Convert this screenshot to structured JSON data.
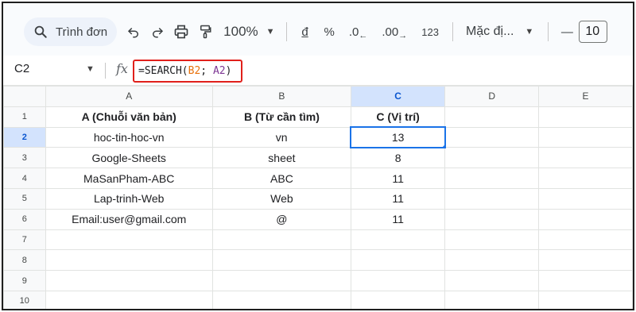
{
  "toolbar": {
    "menu_search_label": "Trình đơn",
    "zoom": "100%",
    "currency_label": "đ",
    "percent_label": "%",
    "decrease_decimal_label": ".0",
    "increase_decimal_label": ".00",
    "number_format_label": "123",
    "font_label": "Mặc đị...",
    "minus_label": "—",
    "font_size": "10"
  },
  "formula_bar": {
    "cell_ref": "C2",
    "fx_label": "fx",
    "formula_prefix": "=SEARCH(",
    "formula_ref1": "B2",
    "formula_sep": "; ",
    "formula_ref2": "A2",
    "formula_suffix": ")"
  },
  "sheet": {
    "columns": [
      "A",
      "B",
      "C",
      "D",
      "E"
    ],
    "rows": [
      {
        "n": "1",
        "a": "A (Chuỗi văn bản)",
        "b": "B (Từ cần tìm)",
        "c": "C (Vị trí)"
      },
      {
        "n": "2",
        "a": "hoc-tin-hoc-vn",
        "b": "vn",
        "c": "13"
      },
      {
        "n": "3",
        "a": "Google-Sheets",
        "b": "sheet",
        "c": "8"
      },
      {
        "n": "4",
        "a": "MaSanPham-ABC",
        "b": "ABC",
        "c": "11"
      },
      {
        "n": "5",
        "a": "Lap-trinh-Web",
        "b": "Web",
        "c": "11"
      },
      {
        "n": "6",
        "a": "Email:user@gmail.com",
        "b": "@",
        "c": "11"
      },
      {
        "n": "7",
        "a": "",
        "b": "",
        "c": ""
      },
      {
        "n": "8",
        "a": "",
        "b": "",
        "c": ""
      },
      {
        "n": "9",
        "a": "",
        "b": "",
        "c": ""
      },
      {
        "n": "10",
        "a": "",
        "b": "",
        "c": ""
      }
    ]
  },
  "colors": {
    "selection_blue": "#1a73e8",
    "highlight_red": "#e0201b",
    "ref_orange": "#e8710a",
    "ref_purple": "#7e3794"
  }
}
